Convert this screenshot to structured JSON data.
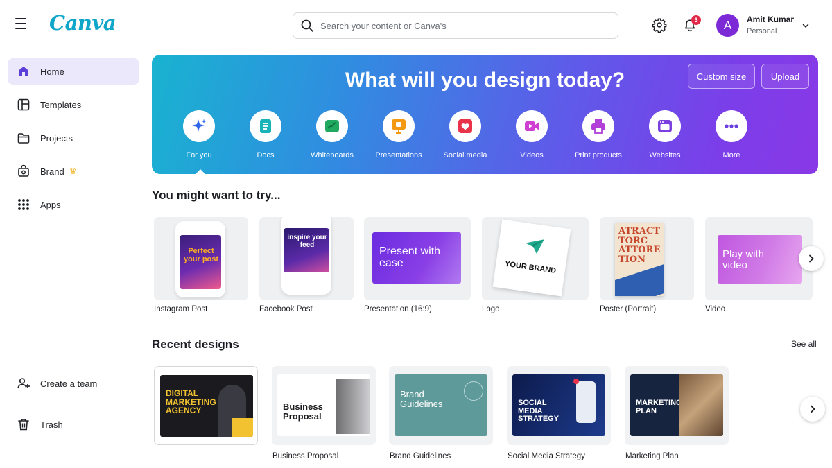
{
  "app": {
    "logo_text": "Canva"
  },
  "search": {
    "placeholder": "Search your content or Canva's"
  },
  "notifications": {
    "count": "3"
  },
  "user": {
    "initial": "A",
    "name": "Amit Kumar",
    "plan": "Personal"
  },
  "sidebar": {
    "items": [
      {
        "label": "Home",
        "icon": "home-icon",
        "active": true
      },
      {
        "label": "Templates",
        "icon": "templates-icon"
      },
      {
        "label": "Projects",
        "icon": "folder-icon"
      },
      {
        "label": "Brand",
        "icon": "brand-icon",
        "badge_icon": "crown-icon"
      },
      {
        "label": "Apps",
        "icon": "apps-grid-icon"
      }
    ],
    "bottom_items": [
      {
        "label": "Create a team",
        "icon": "add-person-icon"
      },
      {
        "label": "Trash",
        "icon": "trash-icon"
      }
    ]
  },
  "hero": {
    "title": "What will you design today?",
    "custom_size_label": "Custom size",
    "upload_label": "Upload",
    "categories": [
      {
        "label": "For you",
        "icon": "sparkle-icon",
        "color": "#2f66e8"
      },
      {
        "label": "Docs",
        "icon": "docs-icon",
        "color": "#19b3b8"
      },
      {
        "label": "Whiteboards",
        "icon": "whiteboard-icon",
        "color": "#1faa5f"
      },
      {
        "label": "Presentations",
        "icon": "presentation-icon",
        "color": "#f39a12"
      },
      {
        "label": "Social media",
        "icon": "heart-icon",
        "color": "#e8334a"
      },
      {
        "label": "Videos",
        "icon": "video-icon",
        "color": "#cf3fd1"
      },
      {
        "label": "Print products",
        "icon": "printer-icon",
        "color": "#b13fd8"
      },
      {
        "label": "Websites",
        "icon": "website-icon",
        "color": "#7b3fe0"
      },
      {
        "label": "More",
        "icon": "more-icon",
        "color": "#6a3fe0"
      }
    ]
  },
  "try_section": {
    "title": "You might want to try...",
    "cards": [
      {
        "label": "Instagram Post",
        "thumb_text": "Perfect your post"
      },
      {
        "label": "Facebook Post",
        "thumb_text": "inspire your feed"
      },
      {
        "label": "Presentation (16:9)",
        "thumb_text": "Present with ease"
      },
      {
        "label": "Logo",
        "thumb_text": "YOUR BRAND"
      },
      {
        "label": "Poster (Portrait)",
        "thumb_text": "ATRACT TORC ATTORE TION"
      },
      {
        "label": "Video",
        "thumb_text": "Play with video"
      }
    ]
  },
  "recent_section": {
    "title": "Recent designs",
    "see_all_label": "See all",
    "cards": [
      {
        "label": "",
        "thumb_text": "DIGITAL MARKETING AGENCY"
      },
      {
        "label": "Business Proposal",
        "thumb_text": "Business Proposal"
      },
      {
        "label": "Brand Guidelines",
        "thumb_text": "Brand Guidelines"
      },
      {
        "label": "Social Media Strategy",
        "thumb_text": "SOCIAL MEDIA STRATEGY"
      },
      {
        "label": "Marketing Plan",
        "thumb_text": "MARKETING PLAN"
      }
    ]
  }
}
